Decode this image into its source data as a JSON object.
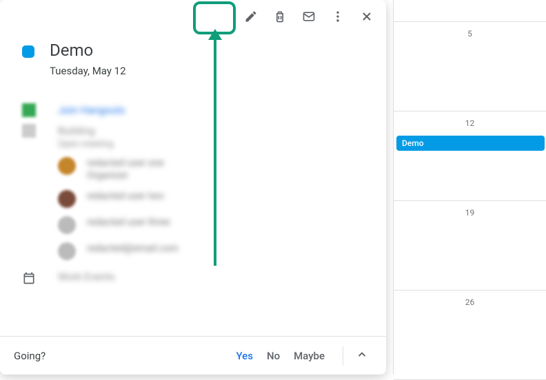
{
  "colors": {
    "event_accent": "#039be5",
    "annotation": "#0f9d7a",
    "rsvp_yes": "#1a73e8"
  },
  "calendar": {
    "days": [
      "5",
      "12",
      "19",
      "26"
    ],
    "event_label": "Demo"
  },
  "popup": {
    "toolbar": {
      "edit_icon": "pencil-icon",
      "delete_icon": "trash-icon",
      "mail_icon": "mail-icon",
      "more_icon": "more-vertical-icon",
      "close_icon": "close-icon"
    },
    "title": "Demo",
    "date": "Tuesday, May 12",
    "meet_link": "Join Hangouts",
    "location_primary": "Building",
    "location_secondary": "Open meeting",
    "calendar_name": "Work Events",
    "guests": [
      {
        "name": "redacted user one",
        "note": "Organizer"
      },
      {
        "name": "redacted user two",
        "note": ""
      },
      {
        "name": "redacted user three",
        "note": ""
      },
      {
        "name": "redacted@email.com",
        "note": ""
      }
    ]
  },
  "footer": {
    "going_label": "Going?",
    "yes": "Yes",
    "no": "No",
    "maybe": "Maybe"
  }
}
